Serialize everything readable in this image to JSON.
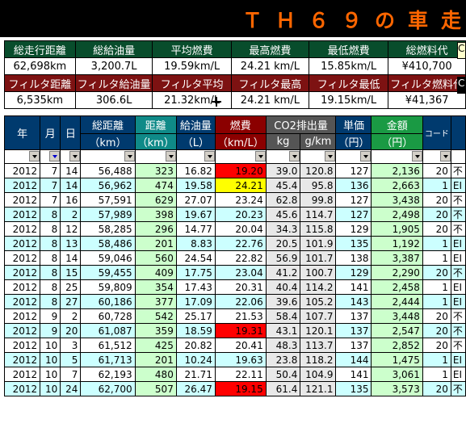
{
  "title": "ＴＨ６９の車走",
  "summary": {
    "row1_labels": [
      "総走行距離",
      "総給油量",
      "平均燃費",
      "最高燃費",
      "最低燃費",
      "総燃料代"
    ],
    "row1_values": [
      "62,698km",
      "3,200.7L",
      "19.59km/L",
      "24.21 km/L",
      "15.85km/L",
      "¥410,700"
    ],
    "row2_labels": [
      "フィルタ距離",
      "フィルタ給油量",
      "フィルタ平均",
      "フィルタ最高",
      "フィルタ最低",
      "フィルタ燃料代"
    ],
    "row2_values": [
      "6,535km",
      "306.6L",
      "21.32km/L",
      "24.21 km/L",
      "19.15km/L",
      "¥41,367"
    ],
    "edge1": "C",
    "edge2": "C"
  },
  "columns": {
    "year": "年",
    "month": "月",
    "day": "日",
    "total_distance": "総距離",
    "total_distance_unit": "（km）",
    "distance": "距離",
    "distance_unit": "（km）",
    "fuel": "給油量",
    "fuel_unit": "（L）",
    "efficiency": "燃費",
    "efficiency_unit": "（km/L）",
    "co2": "CO2排出量",
    "co2_kg": "kg",
    "co2_gkm": "g/km",
    "unit_price": "単価",
    "unit_price_unit": "（円）",
    "amount": "金額",
    "amount_unit": "（円）",
    "code": "コード"
  },
  "colors": {
    "high_efficiency": "#ffff00",
    "low_efficiency": "#ff0000"
  },
  "rows": [
    [
      "2012",
      "7",
      "14",
      "56,488",
      "323",
      "16.82",
      "19.20",
      "39.0",
      "120.8",
      "127",
      "2,136",
      "20",
      "不",
      "low"
    ],
    [
      "2012",
      "7",
      "14",
      "56,962",
      "474",
      "19.58",
      "24.21",
      "45.4",
      "95.8",
      "136",
      "2,663",
      "1",
      "EI",
      "high"
    ],
    [
      "2012",
      "7",
      "16",
      "57,591",
      "629",
      "27.07",
      "23.24",
      "62.8",
      "99.8",
      "127",
      "3,438",
      "20",
      "不",
      ""
    ],
    [
      "2012",
      "8",
      "2",
      "57,989",
      "398",
      "19.67",
      "20.23",
      "45.6",
      "114.7",
      "127",
      "2,498",
      "20",
      "不",
      ""
    ],
    [
      "2012",
      "8",
      "12",
      "58,285",
      "296",
      "14.77",
      "20.04",
      "34.3",
      "115.8",
      "129",
      "1,905",
      "20",
      "不",
      ""
    ],
    [
      "2012",
      "8",
      "13",
      "58,486",
      "201",
      "8.83",
      "22.76",
      "20.5",
      "101.9",
      "135",
      "1,192",
      "1",
      "EI",
      ""
    ],
    [
      "2012",
      "8",
      "14",
      "59,046",
      "560",
      "24.54",
      "22.82",
      "56.9",
      "101.7",
      "138",
      "3,387",
      "1",
      "EI",
      ""
    ],
    [
      "2012",
      "8",
      "15",
      "59,455",
      "409",
      "17.75",
      "23.04",
      "41.2",
      "100.7",
      "129",
      "2,290",
      "20",
      "不",
      ""
    ],
    [
      "2012",
      "8",
      "25",
      "59,809",
      "354",
      "17.43",
      "20.31",
      "40.4",
      "114.2",
      "141",
      "2,458",
      "1",
      "EI",
      ""
    ],
    [
      "2012",
      "8",
      "27",
      "60,186",
      "377",
      "17.09",
      "22.06",
      "39.6",
      "105.2",
      "143",
      "2,444",
      "1",
      "EI",
      ""
    ],
    [
      "2012",
      "9",
      "2",
      "60,728",
      "542",
      "25.17",
      "21.53",
      "58.4",
      "107.7",
      "137",
      "3,448",
      "20",
      "不",
      ""
    ],
    [
      "2012",
      "9",
      "20",
      "61,087",
      "359",
      "18.59",
      "19.31",
      "43.1",
      "120.1",
      "137",
      "2,547",
      "20",
      "不",
      "low"
    ],
    [
      "2012",
      "10",
      "3",
      "61,512",
      "425",
      "20.82",
      "20.41",
      "48.3",
      "113.7",
      "137",
      "2,852",
      "20",
      "不",
      ""
    ],
    [
      "2012",
      "10",
      "5",
      "61,713",
      "201",
      "10.24",
      "19.63",
      "23.8",
      "118.2",
      "144",
      "1,475",
      "1",
      "EI",
      ""
    ],
    [
      "2012",
      "10",
      "7",
      "62,193",
      "480",
      "21.71",
      "22.11",
      "50.4",
      "104.9",
      "141",
      "3,061",
      "1",
      "EI",
      ""
    ],
    [
      "2012",
      "10",
      "24",
      "62,700",
      "507",
      "26.47",
      "19.15",
      "61.4",
      "121.1",
      "135",
      "3,573",
      "20",
      "不",
      "low"
    ]
  ]
}
